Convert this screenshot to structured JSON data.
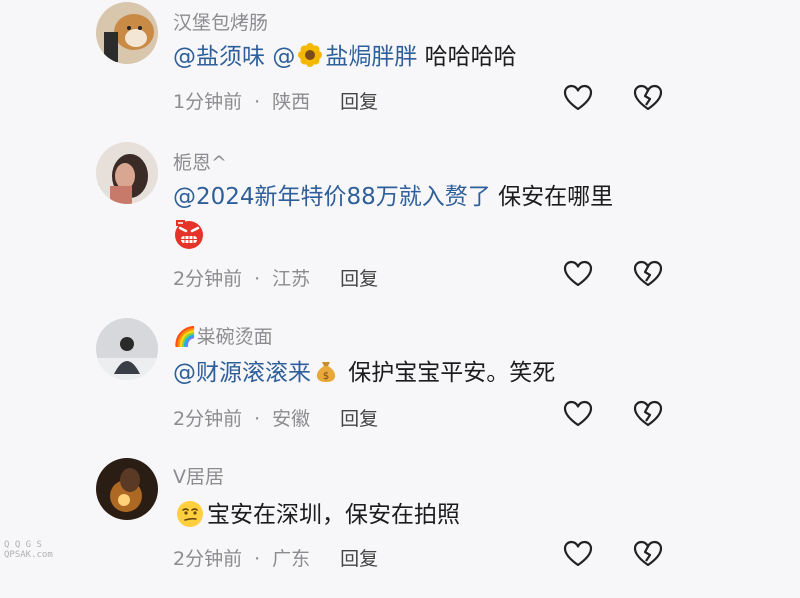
{
  "comments": [
    {
      "username": "汉堡包烤肠",
      "mention1": "@盐须味",
      "mention2": "@",
      "mention2_name": "盐焗胖胖",
      "text": " 哈哈哈哈",
      "time": "1分钟前",
      "location": "陕西",
      "reply": "回复"
    },
    {
      "username": "栀恩^",
      "mention1": "@2024新年特价88万就入赘了",
      "text": " 保安在哪里",
      "time": "2分钟前",
      "location": "江苏",
      "reply": "回复"
    },
    {
      "username": "🌈粜碗烫面",
      "mention1": "@财源滚滚来",
      "text": " 保护宝宝平安。笑死",
      "time": "2分钟前",
      "location": "安徽",
      "reply": "回复"
    },
    {
      "username": "V居居",
      "text": "宝安在深圳，保安在拍照",
      "time": "2分钟前",
      "location": "广东",
      "reply": "回复"
    }
  ],
  "icons": {
    "like": "heart-outline-icon",
    "dislike": "broken-heart-outline-icon"
  },
  "watermark": {
    "line1": "Q Q G S",
    "line2": "QPSAK.com"
  }
}
